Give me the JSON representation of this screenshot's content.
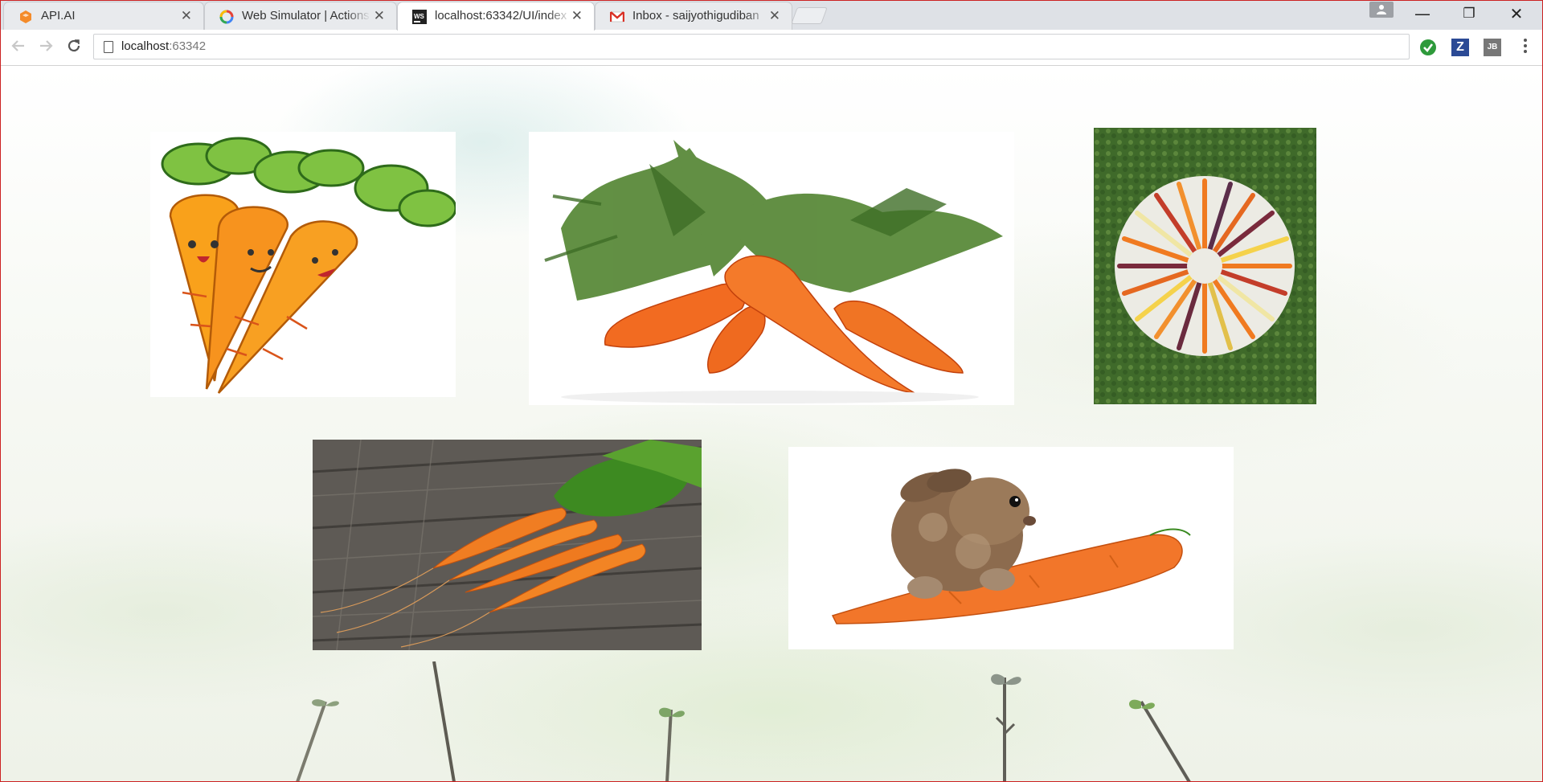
{
  "tabs": [
    {
      "title": "API.AI",
      "favicon": "api-ai-icon",
      "active": false
    },
    {
      "title": "Web Simulator | Actions",
      "favicon": "google-icon",
      "active": false
    },
    {
      "title": "localhost:63342/UI/index",
      "favicon": "webstorm-icon",
      "active": true
    },
    {
      "title": "Inbox - saijyothigudiban",
      "favicon": "gmail-icon",
      "active": false
    }
  ],
  "close_glyph": "✕",
  "window_controls": {
    "minimize": "—",
    "restore": "❐",
    "close": "✕"
  },
  "address_bar": {
    "host": "localhost",
    "port": ":63342"
  },
  "extensions": [
    "green-check-icon",
    "zotero-z-icon",
    "jetbrains-jb-icon"
  ],
  "extension_labels": {
    "zotero": "Z",
    "jetbrains": "JB"
  },
  "images": [
    {
      "name": "cartoon-carrots-image",
      "description_icon": "three smiling cartoon carrots"
    },
    {
      "name": "carrot-bunch-image",
      "description_icon": "carrots with green tops"
    },
    {
      "name": "carrot-circle-image",
      "description_icon": "rainbow carrots arranged in a circle"
    },
    {
      "name": "carrots-on-wood-image",
      "description_icon": "carrots on wooden table"
    },
    {
      "name": "bunny-carrot-image",
      "description_icon": "bunny on a carrot"
    }
  ],
  "colors": {
    "carrot": "#f07a28",
    "leaf": "#4f8a2a",
    "tab_active": "#ffffff",
    "tab_inactive": "#e8eaed"
  }
}
